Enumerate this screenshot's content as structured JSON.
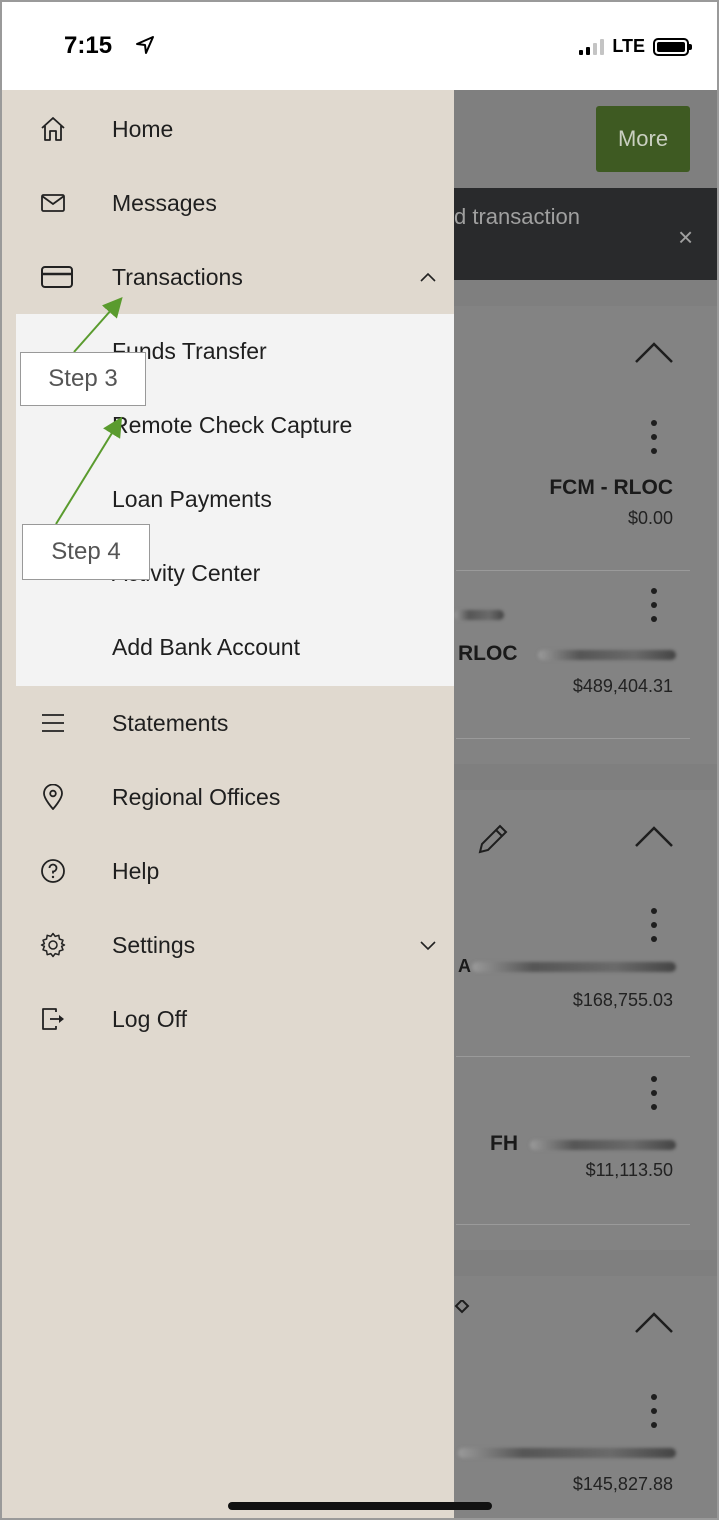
{
  "status_bar": {
    "time": "7:15",
    "network": "LTE",
    "icons": [
      "location-arrow-icon",
      "signal-icon",
      "battery-icon"
    ]
  },
  "background_app": {
    "more_button": "More",
    "banner_text": "d transaction",
    "banner_close": "×",
    "accounts": [
      {
        "name": "FCM - RLOC",
        "amount": "$0.00"
      },
      {
        "name": "RLOC",
        "amount": "$489,404.31"
      },
      {
        "name": "A",
        "amount": "$168,755.03"
      },
      {
        "name": "FH",
        "amount": "$11,113.50"
      },
      {
        "name": "",
        "amount": "$145,827.88"
      }
    ]
  },
  "menu": {
    "items": [
      {
        "label": "Home",
        "icon": "home-icon"
      },
      {
        "label": "Messages",
        "icon": "envelope-icon"
      },
      {
        "label": "Transactions",
        "icon": "credit-card-icon",
        "expanded": true
      },
      {
        "label": "Statements",
        "icon": "hamburger-icon"
      },
      {
        "label": "Regional Offices",
        "icon": "location-pin-icon"
      },
      {
        "label": "Help",
        "icon": "question-circle-icon"
      },
      {
        "label": "Settings",
        "icon": "gear-icon",
        "expanded": false
      },
      {
        "label": "Log Off",
        "icon": "log-off-icon"
      }
    ],
    "transactions_submenu": [
      {
        "label": "Funds Transfer"
      },
      {
        "label": "Remote Check Capture"
      },
      {
        "label": "Loan Payments"
      },
      {
        "label": "Activity Center"
      },
      {
        "label": "Add Bank Account"
      }
    ]
  },
  "annotations": {
    "step3": "Step 3",
    "step4": "Step 4",
    "arrow_color": "#5a9b2e"
  },
  "colors": {
    "drawer_bg": "#e0d9cf",
    "submenu_bg": "#f3f3f3",
    "more_button": "#3e5a22",
    "overlay": "#7f7f7f"
  }
}
